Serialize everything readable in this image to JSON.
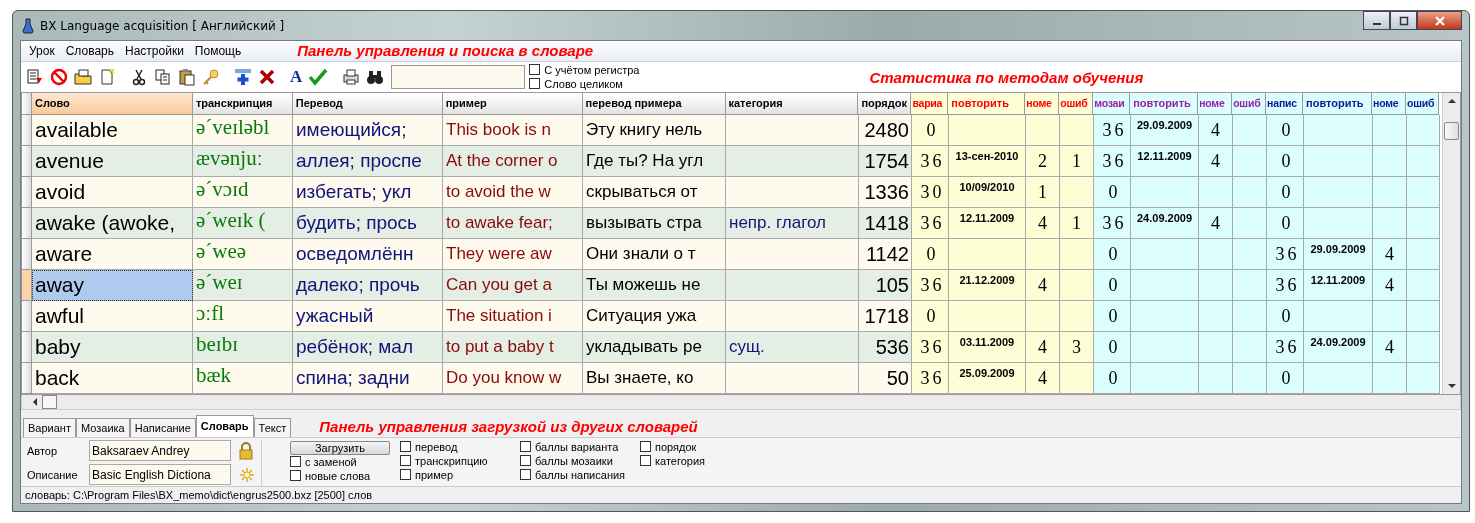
{
  "window": {
    "title": "BX Language acquisition [ Английский ]"
  },
  "menu": [
    {
      "label": "Урок"
    },
    {
      "label": "Словарь"
    },
    {
      "label": "Настройки"
    },
    {
      "label": "Помощь"
    }
  ],
  "annotations": {
    "top": "Панель управления и поиска в словаре",
    "stats": "Статистика по методам обучения",
    "bottom": "Панель управления загрузкой из других словарей"
  },
  "toolbar": {
    "font_button": "A",
    "options": [
      {
        "label": "С учётом регистра",
        "checked": false
      },
      {
        "label": "Слово целиком",
        "checked": false
      }
    ]
  },
  "table": {
    "columns": [
      {
        "label": "Слово",
        "kind": "word",
        "current": true
      },
      {
        "label": "транскрипция",
        "kind": "transcription",
        "current": false
      },
      {
        "label": "Перевод",
        "kind": "translation",
        "current": false
      },
      {
        "label": "пример",
        "kind": "example",
        "current": false
      },
      {
        "label": "перевод примера",
        "kind": "example_translation",
        "current": false
      },
      {
        "label": "категория",
        "kind": "category",
        "current": false
      },
      {
        "label": "порядок",
        "kind": "order",
        "current": false
      },
      {
        "label": "вариа",
        "kind": "score",
        "color": "#ff0000",
        "current": false
      },
      {
        "label": "повторить",
        "kind": "date",
        "color": "#ff0000",
        "current": false
      },
      {
        "label": "номе",
        "kind": "count",
        "color": "#ff0000",
        "current": false
      },
      {
        "label": "ошиб",
        "kind": "count",
        "color": "#ff0000",
        "current": false
      },
      {
        "label": "мозаи",
        "kind": "score",
        "color": "#9b1fa6",
        "current": false
      },
      {
        "label": "повторить",
        "kind": "date",
        "color": "#9b1fa6",
        "current": false
      },
      {
        "label": "номе",
        "kind": "count",
        "color": "#9b1fa6",
        "current": false
      },
      {
        "label": "ошиб",
        "kind": "count",
        "color": "#9b1fa6",
        "current": false
      },
      {
        "label": "напис",
        "kind": "score",
        "color": "#0a1a96",
        "current": false
      },
      {
        "label": "повторить",
        "kind": "date",
        "color": "#0a1a96",
        "current": false
      },
      {
        "label": "номе",
        "kind": "count",
        "color": "#0a1a96",
        "current": false
      },
      {
        "label": "ошиб",
        "kind": "count",
        "color": "#0a1a96",
        "current": false
      }
    ],
    "rows": [
      {
        "selected": false,
        "cells": [
          "available",
          "ə´veɪləbl",
          "имеющийся;",
          "This book is n",
          "Эту книгу нель",
          "",
          "2480",
          "0",
          "",
          "",
          "",
          "36",
          "29.09.2009",
          "4",
          "",
          "0",
          "",
          "",
          ""
        ]
      },
      {
        "selected": false,
        "cells": [
          "avenue",
          "ævənjuː",
          "аллея; проспе",
          "At the corner o",
          "Где ты? На угл",
          "",
          "1754",
          "36",
          "13-сен-2010",
          "2",
          "1",
          "36",
          "12.11.2009",
          "4",
          "",
          "0",
          "",
          "",
          ""
        ]
      },
      {
        "selected": false,
        "cells": [
          "avoid",
          "ə´vɔɪd",
          "избегать; укл",
          "to avoid the w",
          "скрываться от",
          "",
          "1336",
          "30",
          "10/09/2010",
          "1",
          "",
          "0",
          "",
          "",
          "",
          "0",
          "",
          "",
          ""
        ]
      },
      {
        "selected": false,
        "cells": [
          "awake (awoke,",
          "ə´weɪk (",
          "будить; прось",
          "to awake fear;",
          "вызывать стра",
          "непр. глагол",
          "1418",
          "36",
          "12.11.2009",
          "4",
          "1",
          "36",
          "24.09.2009",
          "4",
          "",
          "0",
          "",
          "",
          ""
        ]
      },
      {
        "selected": false,
        "cells": [
          "aware",
          "ə´weə",
          "осведомлённ",
          "They were aw",
          "Они знали о т",
          "",
          "1142",
          "0",
          "",
          "",
          "",
          "0",
          "",
          "",
          "",
          "36",
          "29.09.2009",
          "4",
          ""
        ]
      },
      {
        "selected": true,
        "cells": [
          "away",
          "ə´weɪ",
          "далеко; прочь",
          "Can you get a",
          "Ты можешь не",
          "",
          "105",
          "36",
          "21.12.2009",
          "4",
          "",
          "0",
          "",
          "",
          "",
          "36",
          "12.11.2009",
          "4",
          ""
        ]
      },
      {
        "selected": false,
        "cells": [
          "awful",
          "ɔːfl",
          "ужасный",
          "The situation i",
          "Ситуация ужа",
          "",
          "1718",
          "0",
          "",
          "",
          "",
          "0",
          "",
          "",
          "",
          "0",
          "",
          "",
          ""
        ]
      },
      {
        "selected": false,
        "cells": [
          "baby",
          "beɪbɪ",
          "ребёнок; мал",
          "to put a baby t",
          "укладывать ре",
          "сущ.",
          "536",
          "36",
          "03.11.2009",
          "4",
          "3",
          "0",
          "",
          "",
          "",
          "36",
          "24.09.2009",
          "4",
          ""
        ]
      },
      {
        "selected": false,
        "cells": [
          "back",
          "bæk",
          "спина; задни",
          "Do you know w",
          "Вы знаете, ко",
          "",
          "50",
          "36",
          "25.09.2009",
          "4",
          "",
          "0",
          "",
          "",
          "",
          "0",
          "",
          "",
          ""
        ]
      }
    ]
  },
  "tabs": [
    {
      "label": "Вариант",
      "selected": false
    },
    {
      "label": "Мозаика",
      "selected": false
    },
    {
      "label": "Написание",
      "selected": false
    },
    {
      "label": "Словарь",
      "selected": true
    },
    {
      "label": "Текст",
      "selected": false
    }
  ],
  "panel": {
    "author_label": "Автор",
    "author": "Baksaraev Andrey",
    "description_label": "Описание",
    "description": "Basic English Dictiona",
    "load_button": "Загрузить",
    "option_columns": [
      [
        {
          "label": "с заменой",
          "checked": false
        },
        {
          "label": "новые слова",
          "checked": false
        }
      ],
      [
        {
          "label": "перевод",
          "checked": false
        },
        {
          "label": "транскрипцию",
          "checked": false
        },
        {
          "label": "пример",
          "checked": false
        }
      ],
      [
        {
          "label": "баллы варианта",
          "checked": false
        },
        {
          "label": "баллы мозаики",
          "checked": false
        },
        {
          "label": "баллы написания",
          "checked": false
        }
      ],
      [
        {
          "label": "порядок",
          "checked": false
        },
        {
          "label": "категория",
          "checked": false
        }
      ]
    ]
  },
  "status_bar": "словарь: C:\\Program Files\\BX_memo\\dict\\engrus2500.bxz [2500] слов"
}
